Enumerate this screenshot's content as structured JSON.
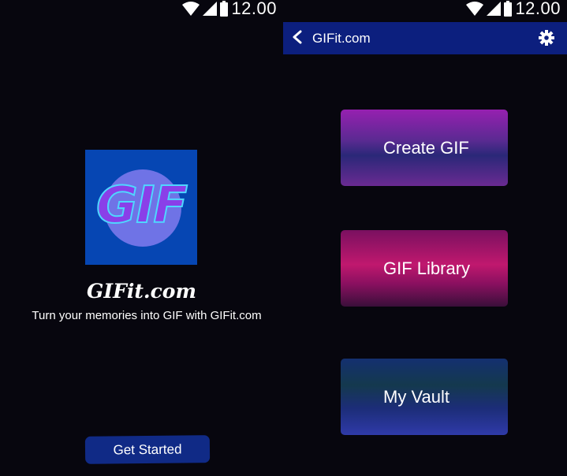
{
  "status_bar": {
    "time": "12.00",
    "icons": [
      "wifi-icon",
      "signal-icon",
      "battery-icon"
    ]
  },
  "splash": {
    "logo_text": "GIF",
    "app_name": "GIFit.com",
    "tagline": "Turn your memories into GIF with GIFit.com",
    "get_started_label": "Get Started"
  },
  "menu": {
    "app_bar": {
      "title": "GIFit.com",
      "back_icon": "back-arrow-icon",
      "settings_icon": "gear-icon"
    },
    "buttons": [
      {
        "label": "Create GIF"
      },
      {
        "label": "GIF Library"
      },
      {
        "label": "My Vault"
      }
    ]
  },
  "colors": {
    "background": "#07060e",
    "app_bar": "#0c1f7e",
    "get_started": "#102a86",
    "logo_bg": "#0646b3"
  }
}
